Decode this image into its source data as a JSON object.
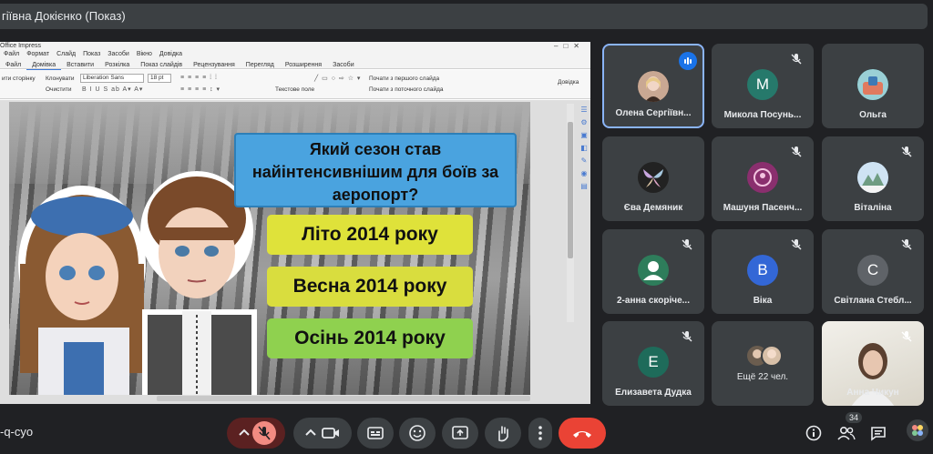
{
  "meeting": {
    "title": "гіївна Докієнко (Показ)",
    "code": "-q-cyo",
    "participants_count": "34"
  },
  "impress": {
    "window_title": "Office Impress",
    "menus": [
      "Файл",
      "Формат",
      "Слайд",
      "Показ",
      "Засоби",
      "Вікно",
      "Довідка"
    ],
    "tabs": [
      "Файл",
      "Домівка",
      "Вставити",
      "Розкілка",
      "Показ слайдів",
      "Рецензування",
      "Перегляд",
      "Розширення",
      "Засоби"
    ],
    "active_tab": "Домівка",
    "toolbar": {
      "style_label": "ити сторінку",
      "clone_label": "Клонувати",
      "clear_label": "Очистити",
      "font_name": "Liberation Sans",
      "font_size": "18 pt",
      "textbox_label": "Текстове поле",
      "start_first": "Почати з першого слайда",
      "start_current": "Почати з поточного слайда",
      "help_label": "Довідка"
    }
  },
  "slide": {
    "question": "Який сезон став найінтенсивнішим для боїв за аеропорт?",
    "answers": [
      "Літо 2014 року",
      "Весна 2014 року",
      "Осінь 2014 року"
    ]
  },
  "participants": [
    {
      "name": "Олена Сергіївн...",
      "avatar_type": "photo",
      "color": "#8a6a5a",
      "speaking": true
    },
    {
      "name": "Микола Посунь...",
      "avatar_type": "letter",
      "letter": "М",
      "color": "#26796b",
      "muted": true
    },
    {
      "name": "Ольга",
      "avatar_type": "image",
      "color": "#4aa3a3",
      "muted": false
    },
    {
      "name": "Єва Демяник",
      "avatar_type": "image",
      "color": "#2a2a2a",
      "muted": false
    },
    {
      "name": "Машуня Пасенч...",
      "avatar_type": "image",
      "color": "#7b2a63",
      "muted": true
    },
    {
      "name": "Віталіна",
      "avatar_type": "image",
      "color": "#a7c7e7",
      "muted": true
    },
    {
      "name": "2-анна скорічe...",
      "avatar_type": "icon",
      "color": "#2e7d5b",
      "muted": true
    },
    {
      "name": "Віка",
      "avatar_type": "letter",
      "letter": "В",
      "color": "#3367d6",
      "muted": true
    },
    {
      "name": "Світлана Стебл...",
      "avatar_type": "letter",
      "letter": "С",
      "color": "#5f6368",
      "muted": true
    },
    {
      "name": "Елизавета Дудка",
      "avatar_type": "letter",
      "letter": "Е",
      "color": "#1e6b5a",
      "muted": true
    },
    {
      "name": "Ещё 22 чел.",
      "avatar_type": "group",
      "color": "#6b5d4f",
      "muted": false
    },
    {
      "name": "Анна Чикун",
      "avatar_type": "video",
      "color": "#e4e1d8",
      "muted": true
    }
  ],
  "colors": {
    "background": "#202124",
    "tile": "#3c4043",
    "active_border": "#8ab4f8",
    "end_call": "#ea4335",
    "mic_off": "#5b2121",
    "question_bg": "#4aa3df",
    "answer_yellow": "#dfe23a",
    "answer_green": "#8fd14f"
  },
  "controls": {
    "icons": [
      "chevron-up-icon",
      "mic-off-icon",
      "chevron-up-icon",
      "camera-icon",
      "captions-icon",
      "emoji-icon",
      "present-icon",
      "raise-hand-icon",
      "more-icon",
      "end-call-icon"
    ],
    "right_icons": [
      "info-icon",
      "people-icon",
      "chat-icon",
      "activities-icon"
    ]
  }
}
